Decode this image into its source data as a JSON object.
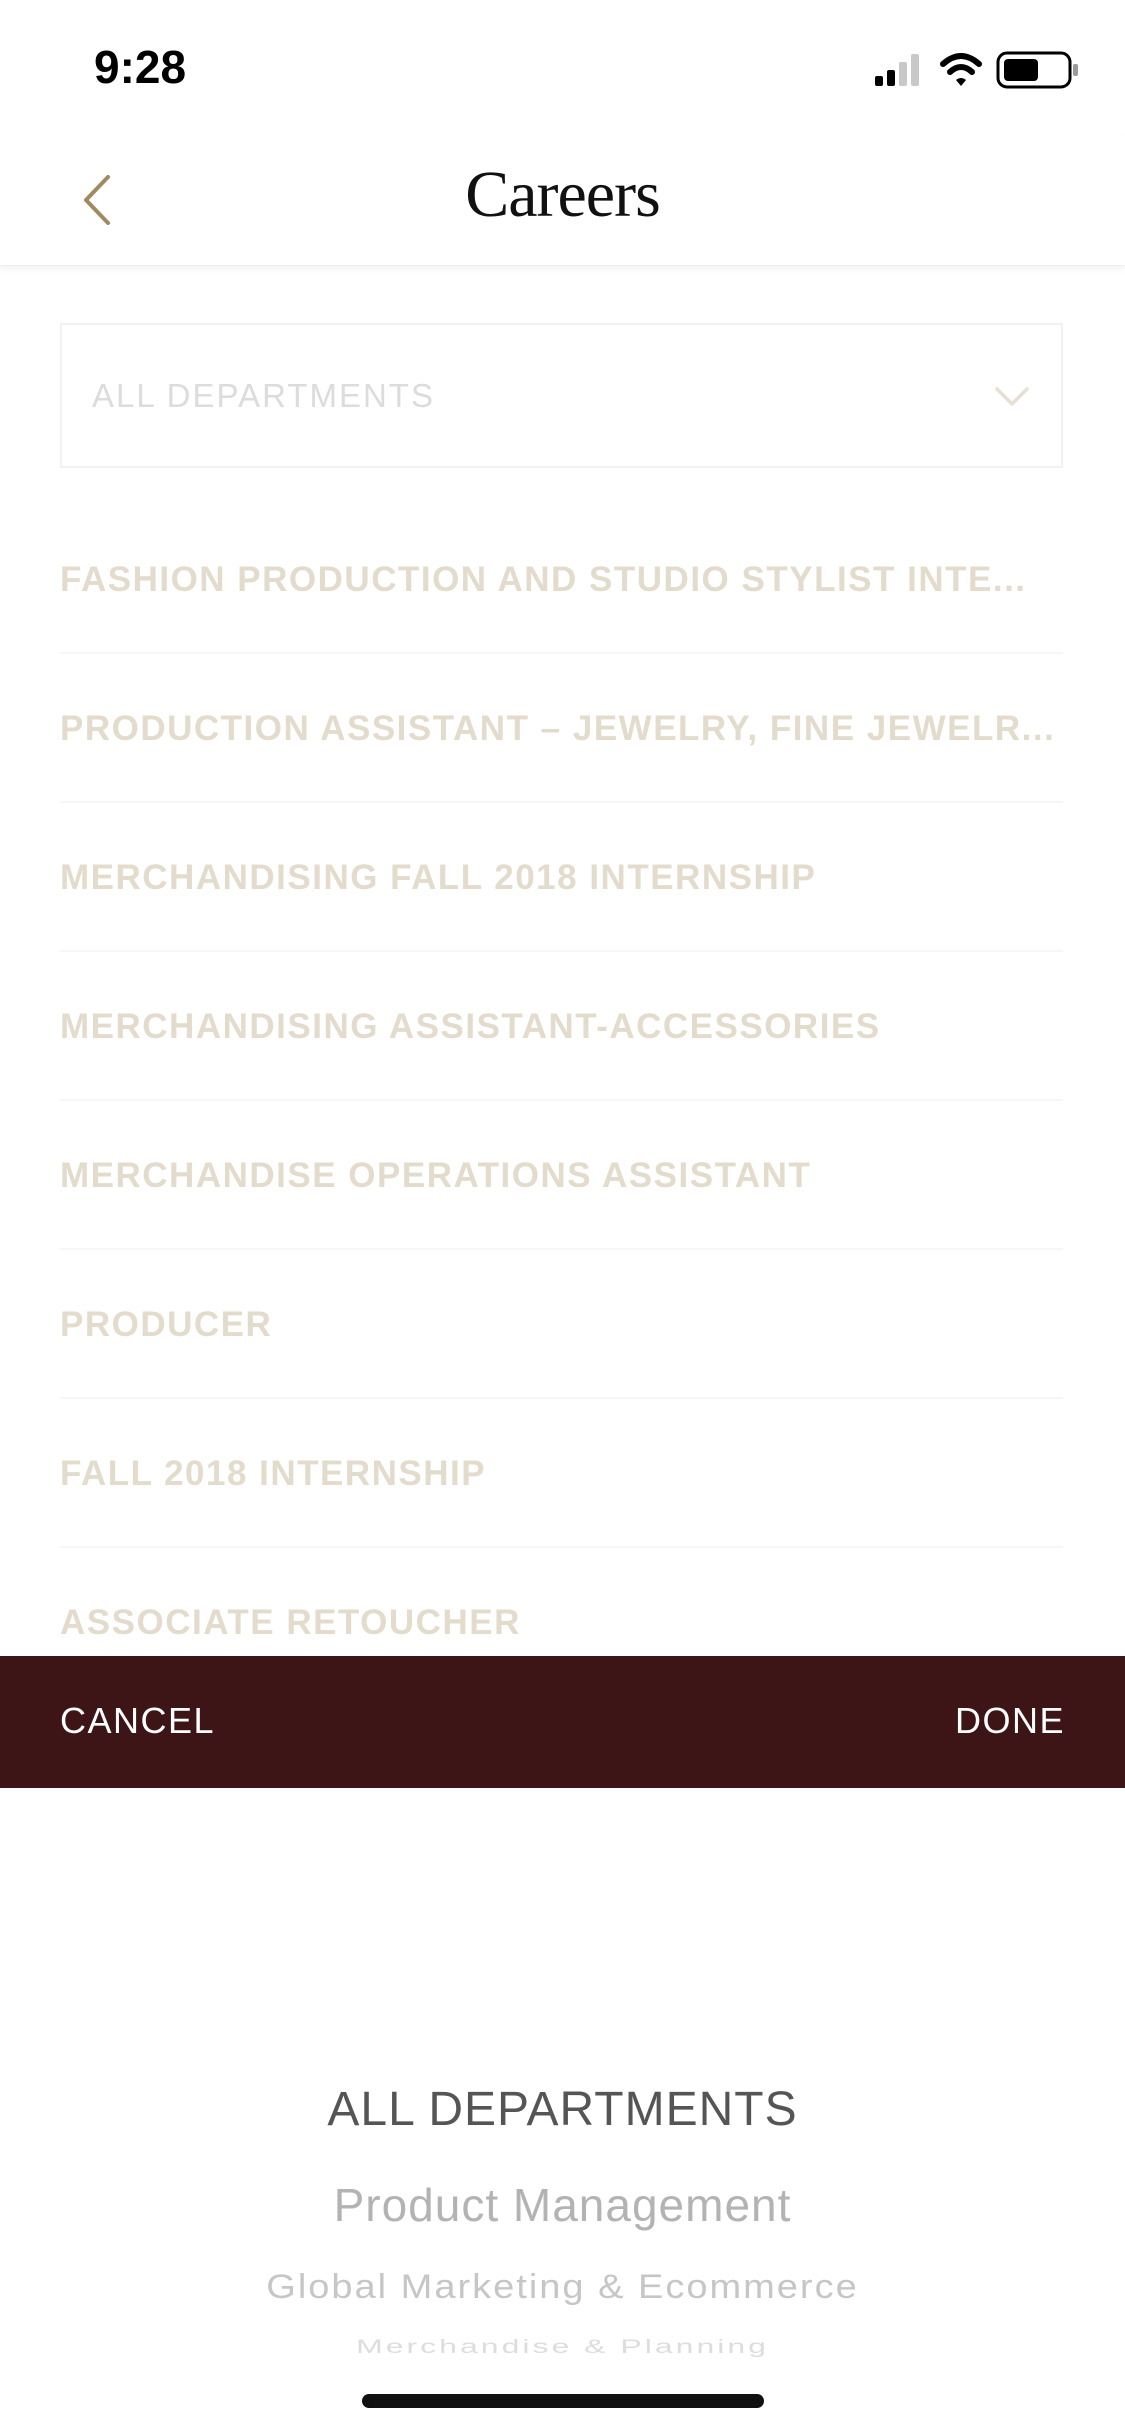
{
  "status": {
    "time": "9:28"
  },
  "nav": {
    "title": "Careers"
  },
  "department_select": {
    "value": "ALL DEPARTMENTS"
  },
  "jobs": [
    "FASHION PRODUCTION AND  STUDIO STYLIST INTE...",
    "PRODUCTION ASSISTANT – JEWELRY, FINE JEWELR...",
    "MERCHANDISING FALL 2018 INTERNSHIP",
    "MERCHANDISING ASSISTANT-ACCESSORIES",
    "MERCHANDISE OPERATIONS ASSISTANT",
    "PRODUCER",
    "FALL 2018 INTERNSHIP",
    "ASSOCIATE RETOUCHER"
  ],
  "action_bar": {
    "cancel_label": "CANCEL",
    "done_label": "DONE"
  },
  "picker": {
    "options": [
      "ALL DEPARTMENTS",
      "Product Management",
      "Global Marketing & Ecommerce",
      "Merchandise & Planning"
    ]
  },
  "colors": {
    "action_bar": "#3d1516",
    "accent_gold": "#a38a5e",
    "job_text": "#e3dccd"
  }
}
